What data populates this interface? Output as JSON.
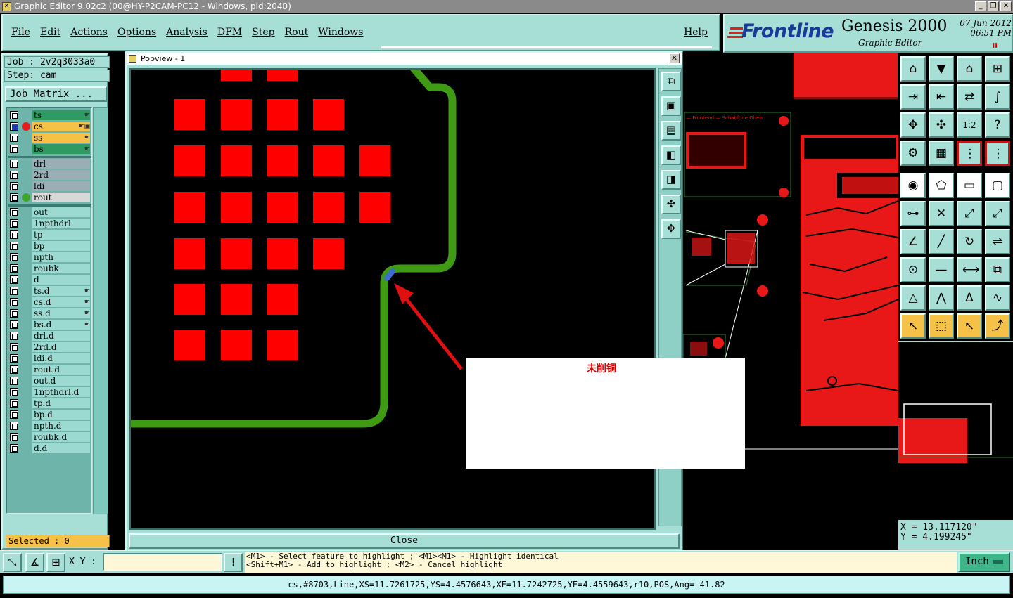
{
  "window": {
    "title": "Graphic Editor 9.02c2 (00@HY-P2CAM-PC12 - Windows, pid:2040)",
    "controls": [
      "_",
      "❐",
      "✕"
    ]
  },
  "menu": {
    "items": [
      "File",
      "Edit",
      "Actions",
      "Options",
      "Analysis",
      "DFM",
      "Step",
      "Rout",
      "Windows"
    ],
    "help": "Help"
  },
  "brand": {
    "logo": "Frontline",
    "product": "Genesis 2000",
    "subtitle": "Graphic Editor",
    "date": "07 Jun 2012",
    "time": "06:51 PM",
    "pause": "II"
  },
  "job": {
    "job_line": "Job : 2v2q3033a0",
    "step_line": "Step: cam",
    "matrix_button": "Job Matrix ..."
  },
  "layers": {
    "board": [
      {
        "name": "ts",
        "color": "#2f9a62",
        "flag": "☛"
      },
      {
        "name": "cs",
        "color": "#f5c147",
        "flag": "☛▣",
        "active": true,
        "dot": "#e51c1c"
      },
      {
        "name": "ss",
        "color": "#f5c147",
        "flag": "☛"
      },
      {
        "name": "bs",
        "color": "#2f9a62",
        "flag": "☛"
      }
    ],
    "drill": [
      {
        "name": "drl",
        "color": "#9aaeb6"
      },
      {
        "name": "2rd",
        "color": "#9aaeb6"
      },
      {
        "name": "ldi",
        "color": "#9aaeb6"
      },
      {
        "name": "rout",
        "color": "#d8d8d8",
        "dot": "#3fa52a"
      }
    ],
    "misc": [
      {
        "name": "out",
        "color": "#9cd9d0"
      },
      {
        "name": "1npthdrl",
        "color": "#9cd9d0"
      },
      {
        "name": "tp",
        "color": "#9cd9d0"
      },
      {
        "name": "bp",
        "color": "#9cd9d0"
      },
      {
        "name": "npth",
        "color": "#9cd9d0"
      },
      {
        "name": "roubk",
        "color": "#9cd9d0"
      },
      {
        "name": "d",
        "color": "#9cd9d0"
      },
      {
        "name": "ts.d",
        "color": "#9cd9d0",
        "flag": "☛"
      },
      {
        "name": "cs.d",
        "color": "#9cd9d0",
        "flag": "☛"
      },
      {
        "name": "ss.d",
        "color": "#9cd9d0",
        "flag": "☛"
      },
      {
        "name": "bs.d",
        "color": "#9cd9d0",
        "flag": "☛"
      },
      {
        "name": "drl.d",
        "color": "#9cd9d0"
      },
      {
        "name": "2rd.d",
        "color": "#9cd9d0"
      },
      {
        "name": "ldi.d",
        "color": "#9cd9d0"
      },
      {
        "name": "rout.d",
        "color": "#9cd9d0"
      },
      {
        "name": "out.d",
        "color": "#9cd9d0"
      },
      {
        "name": "1npthdrl.d",
        "color": "#9cd9d0"
      },
      {
        "name": "tp.d",
        "color": "#9cd9d0"
      },
      {
        "name": "bp.d",
        "color": "#9cd9d0"
      },
      {
        "name": "npth.d",
        "color": "#9cd9d0"
      },
      {
        "name": "roubk.d",
        "color": "#9cd9d0"
      },
      {
        "name": "d.d",
        "color": "#9cd9d0"
      }
    ]
  },
  "selection": {
    "label": "Selected : 0"
  },
  "popview": {
    "title": "Popview - 1",
    "close_label": "Close",
    "tools": [
      "zoom-window-icon",
      "pan-up-icon",
      "pan-down-icon",
      "pan-left-icon",
      "pan-right-icon",
      "zoom-in-icon",
      "zoom-out-icon"
    ]
  },
  "annotation": {
    "text": "未削铜"
  },
  "coords": {
    "x": "X = 13.117120\"",
    "y": "Y = 4.199245\""
  },
  "xy_input": {
    "label": "X Y :",
    "value": ""
  },
  "messages": {
    "line1": "<M1> - Select feature to highlight ; <M1><M1> - Highlight identical",
    "line2": "<Shift+M1> - Add to highlight ; <M2> - Cancel highlight"
  },
  "units": {
    "label": "Inch"
  },
  "status": {
    "text": "cs,#8703,Line,XS=11.7261725,YS=4.4576643,XE=11.7242725,YE=4.4559643,r10,POS,Ang=-41.82"
  },
  "colors": {
    "copper": "#ff0000",
    "rout": "#3f9a14",
    "panel": "#a7dfd6",
    "highlight": "#f5c147"
  }
}
